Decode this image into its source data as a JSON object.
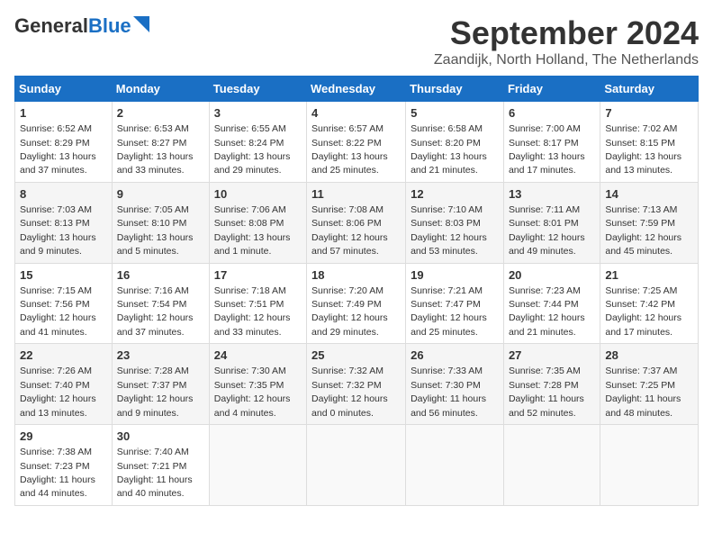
{
  "header": {
    "logo_general": "General",
    "logo_blue": "Blue",
    "month_title": "September 2024",
    "location": "Zaandijk, North Holland, The Netherlands"
  },
  "weekdays": [
    "Sunday",
    "Monday",
    "Tuesday",
    "Wednesday",
    "Thursday",
    "Friday",
    "Saturday"
  ],
  "weeks": [
    [
      {
        "day": "1",
        "sunrise": "6:52 AM",
        "sunset": "8:29 PM",
        "daylight": "13 hours and 37 minutes."
      },
      {
        "day": "2",
        "sunrise": "6:53 AM",
        "sunset": "8:27 PM",
        "daylight": "13 hours and 33 minutes."
      },
      {
        "day": "3",
        "sunrise": "6:55 AM",
        "sunset": "8:24 PM",
        "daylight": "13 hours and 29 minutes."
      },
      {
        "day": "4",
        "sunrise": "6:57 AM",
        "sunset": "8:22 PM",
        "daylight": "13 hours and 25 minutes."
      },
      {
        "day": "5",
        "sunrise": "6:58 AM",
        "sunset": "8:20 PM",
        "daylight": "13 hours and 21 minutes."
      },
      {
        "day": "6",
        "sunrise": "7:00 AM",
        "sunset": "8:17 PM",
        "daylight": "13 hours and 17 minutes."
      },
      {
        "day": "7",
        "sunrise": "7:02 AM",
        "sunset": "8:15 PM",
        "daylight": "13 hours and 13 minutes."
      }
    ],
    [
      {
        "day": "8",
        "sunrise": "7:03 AM",
        "sunset": "8:13 PM",
        "daylight": "13 hours and 9 minutes."
      },
      {
        "day": "9",
        "sunrise": "7:05 AM",
        "sunset": "8:10 PM",
        "daylight": "13 hours and 5 minutes."
      },
      {
        "day": "10",
        "sunrise": "7:06 AM",
        "sunset": "8:08 PM",
        "daylight": "13 hours and 1 minute."
      },
      {
        "day": "11",
        "sunrise": "7:08 AM",
        "sunset": "8:06 PM",
        "daylight": "12 hours and 57 minutes."
      },
      {
        "day": "12",
        "sunrise": "7:10 AM",
        "sunset": "8:03 PM",
        "daylight": "12 hours and 53 minutes."
      },
      {
        "day": "13",
        "sunrise": "7:11 AM",
        "sunset": "8:01 PM",
        "daylight": "12 hours and 49 minutes."
      },
      {
        "day": "14",
        "sunrise": "7:13 AM",
        "sunset": "7:59 PM",
        "daylight": "12 hours and 45 minutes."
      }
    ],
    [
      {
        "day": "15",
        "sunrise": "7:15 AM",
        "sunset": "7:56 PM",
        "daylight": "12 hours and 41 minutes."
      },
      {
        "day": "16",
        "sunrise": "7:16 AM",
        "sunset": "7:54 PM",
        "daylight": "12 hours and 37 minutes."
      },
      {
        "day": "17",
        "sunrise": "7:18 AM",
        "sunset": "7:51 PM",
        "daylight": "12 hours and 33 minutes."
      },
      {
        "day": "18",
        "sunrise": "7:20 AM",
        "sunset": "7:49 PM",
        "daylight": "12 hours and 29 minutes."
      },
      {
        "day": "19",
        "sunrise": "7:21 AM",
        "sunset": "7:47 PM",
        "daylight": "12 hours and 25 minutes."
      },
      {
        "day": "20",
        "sunrise": "7:23 AM",
        "sunset": "7:44 PM",
        "daylight": "12 hours and 21 minutes."
      },
      {
        "day": "21",
        "sunrise": "7:25 AM",
        "sunset": "7:42 PM",
        "daylight": "12 hours and 17 minutes."
      }
    ],
    [
      {
        "day": "22",
        "sunrise": "7:26 AM",
        "sunset": "7:40 PM",
        "daylight": "12 hours and 13 minutes."
      },
      {
        "day": "23",
        "sunrise": "7:28 AM",
        "sunset": "7:37 PM",
        "daylight": "12 hours and 9 minutes."
      },
      {
        "day": "24",
        "sunrise": "7:30 AM",
        "sunset": "7:35 PM",
        "daylight": "12 hours and 4 minutes."
      },
      {
        "day": "25",
        "sunrise": "7:32 AM",
        "sunset": "7:32 PM",
        "daylight": "12 hours and 0 minutes."
      },
      {
        "day": "26",
        "sunrise": "7:33 AM",
        "sunset": "7:30 PM",
        "daylight": "11 hours and 56 minutes."
      },
      {
        "day": "27",
        "sunrise": "7:35 AM",
        "sunset": "7:28 PM",
        "daylight": "11 hours and 52 minutes."
      },
      {
        "day": "28",
        "sunrise": "7:37 AM",
        "sunset": "7:25 PM",
        "daylight": "11 hours and 48 minutes."
      }
    ],
    [
      {
        "day": "29",
        "sunrise": "7:38 AM",
        "sunset": "7:23 PM",
        "daylight": "11 hours and 44 minutes."
      },
      {
        "day": "30",
        "sunrise": "7:40 AM",
        "sunset": "7:21 PM",
        "daylight": "11 hours and 40 minutes."
      },
      null,
      null,
      null,
      null,
      null
    ]
  ]
}
